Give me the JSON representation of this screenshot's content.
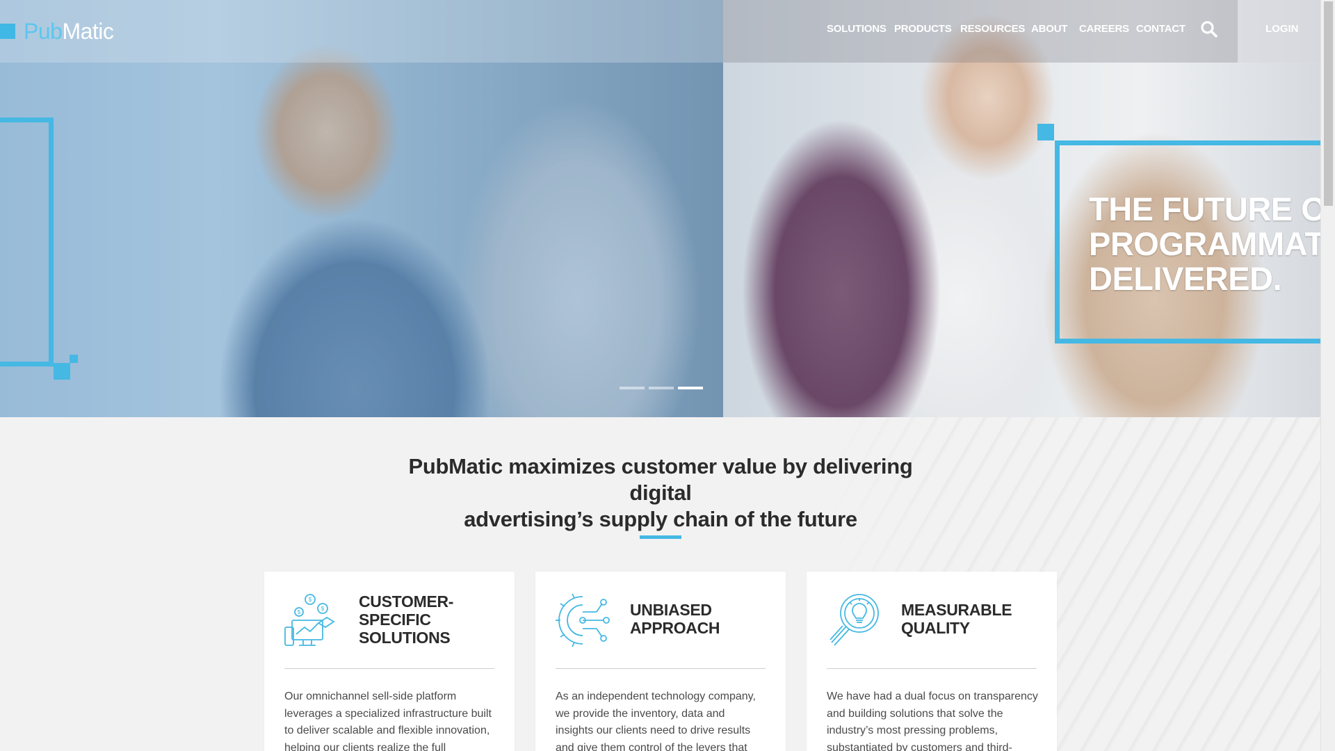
{
  "brand": {
    "logo_pub": "Pub",
    "logo_matic": "Matic"
  },
  "nav": {
    "items": [
      {
        "label": "SOLUTIONS"
      },
      {
        "label": "PRODUCTS"
      },
      {
        "label": "RESOURCES"
      },
      {
        "label": "ABOUT"
      },
      {
        "label": "CAREERS"
      },
      {
        "label": "CONTACT"
      }
    ],
    "search_icon": "search-icon",
    "login_label": "LOGIN"
  },
  "hero": {
    "headline_lines": [
      "THE FUTURE OF",
      "PROGRAMMATIC",
      "DELIVERED."
    ],
    "slides_total": 3,
    "active_slide": 3
  },
  "intro": {
    "tagline_line1": "PubMatic maximizes customer value by delivering digital",
    "tagline_line2": "advertising’s supply chain of the future"
  },
  "cards": [
    {
      "icon": "money-devices-icon",
      "title_lines": [
        "CUSTOMER-",
        "SPECIFIC",
        "SOLUTIONS"
      ],
      "body_lines": [
        "Our omnichannel sell-side platform",
        "leverages a specialized infrastructure built",
        "to deliver scalable and flexible innovation,",
        "helping our clients realize the full"
      ]
    },
    {
      "icon": "gear-network-icon",
      "title_lines": [
        "UNBIASED",
        "APPROACH"
      ],
      "body_lines": [
        "As an independent technology company,",
        "we provide the inventory, data and",
        "insights our clients need to drive results",
        "and give them control of the levers that"
      ]
    },
    {
      "icon": "magnifier-bulb-icon",
      "title_lines": [
        "MEASURABLE",
        "QUALITY"
      ],
      "body_lines": [
        "We have had a dual focus on transparency",
        "and building solutions that solve the",
        "industry’s most pressing problems,",
        "substantiated by customers and third-"
      ]
    }
  ],
  "colors": {
    "accent": "#45b8e3",
    "text_dark": "#2b2b2b",
    "body_text": "#4a4a4a",
    "background": "#f2f2f2"
  }
}
